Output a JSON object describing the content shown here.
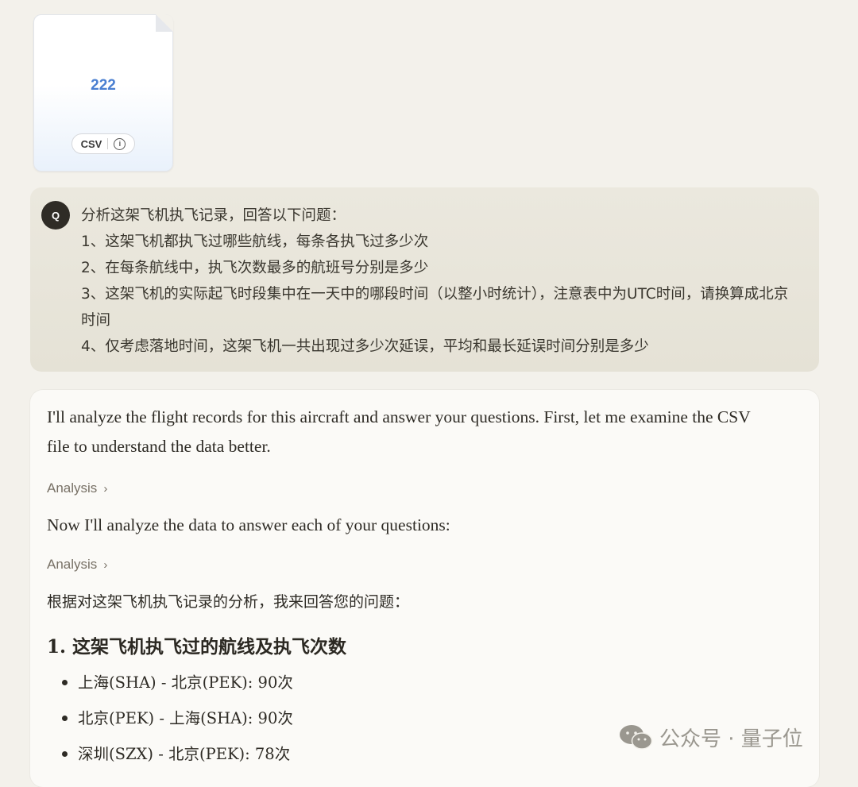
{
  "file": {
    "name": "222",
    "type": "CSV",
    "info_icon": "info-icon"
  },
  "question": {
    "avatar": "Q",
    "lines": [
      "分析这架飞机执飞记录，回答以下问题：",
      "1、这架飞机都执飞过哪些航线，每条各执飞过多少次",
      "2、在每条航线中，执飞次数最多的航班号分别是多少",
      "3、这架飞机的实际起飞时段集中在一天中的哪段时间（以整小时统计），注意表中为UTC时间，请换算成北京时间",
      "4、仅考虑落地时间，这架飞机一共出现过多少次延误，平均和最长延误时间分别是多少"
    ]
  },
  "answer": {
    "intro": "I'll analyze the flight records for this aircraft and answer your questions. First, let me examine the CSV file to understand the data better.",
    "analysis_label_1": "Analysis",
    "next": "Now I'll analyze the data to answer each of your questions:",
    "analysis_label_2": "Analysis",
    "summary": "根据对这架飞机执飞记录的分析，我来回答您的问题：",
    "heading_1": "1. 这架飞机执飞过的航线及执飞次数",
    "routes": [
      "上海(SHA) - 北京(PEK): 90次",
      "北京(PEK) - 上海(SHA): 90次",
      "深圳(SZX) - 北京(PEK): 78次"
    ]
  },
  "watermark": {
    "text": "公众号 · 量子位",
    "icon": "wechat-icon"
  }
}
